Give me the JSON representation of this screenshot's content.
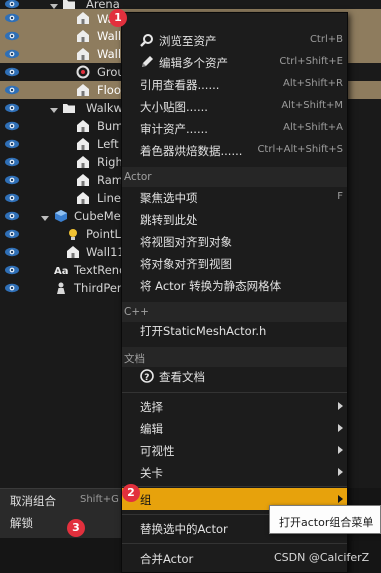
{
  "outliner": {
    "rows": [
      {
        "label": "Arena",
        "type": "folder",
        "selected": false
      },
      {
        "label": "Wall资产",
        "type": "mesh",
        "selected": true
      },
      {
        "label": "Wall",
        "type": "mesh",
        "selected": true
      },
      {
        "label": "Wall",
        "type": "mesh",
        "selected": true
      },
      {
        "label": "Grou",
        "type": "settings",
        "selected": false
      },
      {
        "label": "Floo",
        "type": "mesh",
        "selected": true
      },
      {
        "label": "Walkw",
        "type": "folder",
        "selected": false
      },
      {
        "label": "Bum",
        "type": "mesh",
        "selected": false
      },
      {
        "label": "Left",
        "type": "mesh",
        "selected": false
      },
      {
        "label": "Righ",
        "type": "mesh",
        "selected": false
      },
      {
        "label": "Ram",
        "type": "mesh",
        "selected": false
      },
      {
        "label": "Line",
        "type": "mesh",
        "selected": false
      },
      {
        "label": "CubeMes",
        "type": "cube",
        "selected": false
      },
      {
        "label": "PointL",
        "type": "light",
        "selected": false
      },
      {
        "label": "Wall11",
        "type": "mesh",
        "selected": false
      },
      {
        "label": "TextRend",
        "type": "text",
        "selected": false
      },
      {
        "label": "ThirdPer",
        "type": "pawn",
        "selected": false
      }
    ]
  },
  "bottom_menu": {
    "ungroup": {
      "label": "取消组合",
      "shortcut": "Shift+G"
    },
    "unlock": {
      "label": "解锁"
    }
  },
  "context_menu": {
    "asset_items": [
      {
        "label": "浏览至资产",
        "shortcut": "Ctrl+B",
        "icon": "browse-search-icon"
      },
      {
        "label": "编辑多个资产",
        "shortcut": "Ctrl+Shift+E",
        "icon": "edit-pencil-icon"
      },
      {
        "label": "引用查看器......",
        "shortcut": "Alt+Shift+R"
      },
      {
        "label": "大小贴图......",
        "shortcut": "Alt+Shift+M"
      },
      {
        "label": "审计资产......",
        "shortcut": "Alt+Shift+A"
      },
      {
        "label": "着色器烘焙数据......",
        "shortcut": "Ctrl+Alt+Shift+S"
      }
    ],
    "actor_section": "Actor",
    "actor_items": [
      {
        "label": "聚焦选中项",
        "shortcut": "F"
      },
      {
        "label": "跳转到此处",
        "shortcut": ""
      },
      {
        "label": "将视图对齐到对象",
        "shortcut": ""
      },
      {
        "label": "将对象对齐到视图",
        "shortcut": ""
      },
      {
        "label": "将 Actor 转换为静态网格体",
        "shortcut": ""
      }
    ],
    "cpp_section": "C++",
    "cpp_item": "打开StaticMeshActor.h",
    "docs_section": "文档",
    "docs_item": "查看文档",
    "submenu_items": [
      "选择",
      "编辑",
      "可视性",
      "关卡"
    ],
    "group_item": "组",
    "replace_item": "替换选中的Actor",
    "merge_item": "合并Actor"
  },
  "badges": [
    "1",
    "2",
    "3"
  ],
  "tooltip": "打开actor组合菜单",
  "watermark": "CSDN @CalciferZ",
  "colors": {
    "selection_row": "#8e7c5e",
    "highlight": "#e7a20c",
    "badge": "#e2303d",
    "menu_bg": "#1c1c1c"
  }
}
